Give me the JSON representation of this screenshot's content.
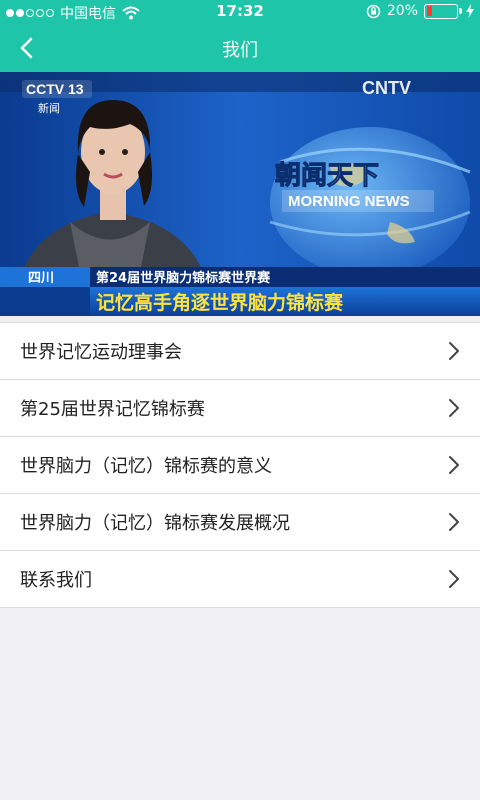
{
  "status_bar": {
    "carrier": "中国电信",
    "time": "17:32",
    "battery_percent": "20%",
    "battery_level": 0.2,
    "battery_color": "#ff3b30",
    "icons": [
      "signal-dots-icon",
      "wifi-icon",
      "rotation-lock-icon",
      "battery-icon",
      "charging-bolt-icon"
    ]
  },
  "nav": {
    "title": "我们",
    "back_icon": "chevron-left-icon",
    "bar_color": "#1ec5a8"
  },
  "banner": {
    "channel_logo": "CCTV 13",
    "channel_sub": "新闻",
    "watermark": "CNTV",
    "program_title": "朝闻天下",
    "program_en": "MORNING NEWS",
    "region": "四川",
    "caption_line1": "第24届世界脑力锦标赛世界赛",
    "caption_line2": "记忆高手角逐世界脑力锦标赛"
  },
  "menu": {
    "items": [
      {
        "label": "世界记忆运动理事会"
      },
      {
        "label": "第25届世界记忆锦标赛"
      },
      {
        "label": "世界脑力（记忆）锦标赛的意义"
      },
      {
        "label": "世界脑力（记忆）锦标赛发展概况"
      },
      {
        "label": "联系我们"
      }
    ],
    "chevron_icon": "chevron-right-icon"
  }
}
